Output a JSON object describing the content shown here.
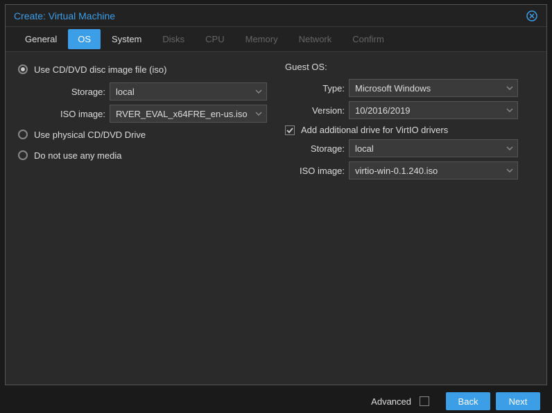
{
  "title": "Create: Virtual Machine",
  "tabs": [
    "General",
    "OS",
    "System",
    "Disks",
    "CPU",
    "Memory",
    "Network",
    "Confirm"
  ],
  "left": {
    "opt_iso": "Use CD/DVD disc image file (iso)",
    "storage_lbl": "Storage:",
    "storage_val": "local",
    "iso_lbl": "ISO image:",
    "iso_val": "RVER_EVAL_x64FRE_en-us.iso",
    "opt_phys": "Use physical CD/DVD Drive",
    "opt_none": "Do not use any media"
  },
  "right": {
    "guest_os": "Guest OS:",
    "type_lbl": "Type:",
    "type_val": "Microsoft Windows",
    "ver_lbl": "Version:",
    "ver_val": "10/2016/2019",
    "virtio_chk": "Add additional drive for VirtIO drivers",
    "storage_lbl": "Storage:",
    "storage_val": "local",
    "iso_lbl": "ISO image:",
    "iso_val": "virtio-win-0.1.240.iso"
  },
  "footer": {
    "advanced": "Advanced",
    "back": "Back",
    "next": "Next"
  }
}
